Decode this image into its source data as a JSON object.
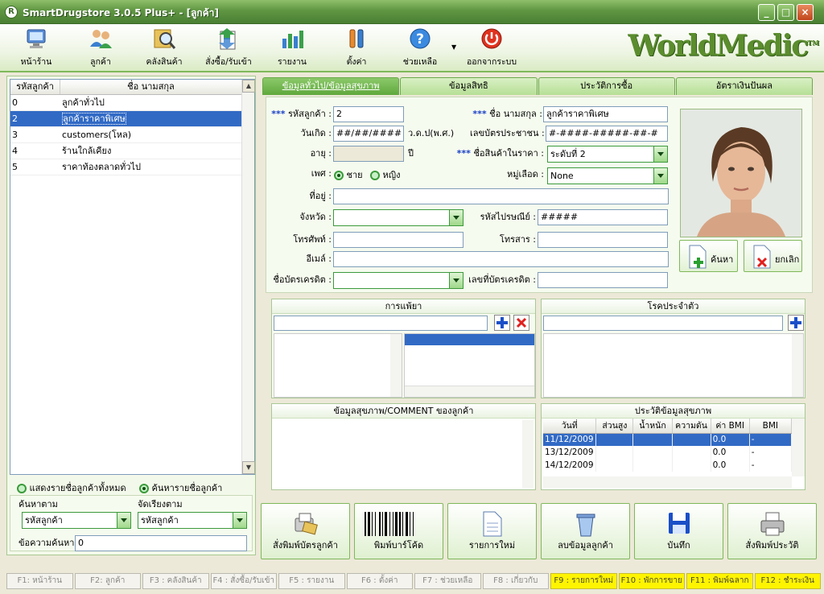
{
  "window": {
    "title": "SmartDrugstore 3.0.5 Plus+ - [ลูกค้า]",
    "brand": "WorldMedic",
    "brand_tm": "TM"
  },
  "toolbar": {
    "items": [
      {
        "label": "หน้าร้าน",
        "icon": "monitor-icon"
      },
      {
        "label": "ลูกค้า",
        "icon": "users-icon"
      },
      {
        "label": "คลังสินค้า",
        "icon": "box-search-icon"
      },
      {
        "label": "สั่งซื้อ/รับเข้า",
        "icon": "order-icon"
      },
      {
        "label": "รายงาน",
        "icon": "chart-icon"
      },
      {
        "label": "ตั้งค่า",
        "icon": "tools-icon"
      },
      {
        "label": "ช่วยเหลือ",
        "icon": "help-icon"
      },
      {
        "label": "ออกจากระบบ",
        "icon": "power-icon"
      }
    ]
  },
  "customer_list": {
    "columns": [
      "รหัสลูกค้า",
      "ชื่อ นามสกุล"
    ],
    "rows": [
      {
        "code": "0",
        "name": "ลูกค้าทั่วไป"
      },
      {
        "code": "2",
        "name": "ลูกค้าราคาพิเศษ"
      },
      {
        "code": "3",
        "name": "customers(โหล)"
      },
      {
        "code": "4",
        "name": "ร้านใกล้เคียง"
      },
      {
        "code": "5",
        "name": "ราคาท้องตลาดทั่วไป"
      }
    ],
    "selected": "2"
  },
  "search": {
    "show_all": "แสดงรายชื่อลูกค้าทั้งหมด",
    "search_names": "ค้นหารายชื่อลูกค้า",
    "search_by_label": "ค้นหาตาม",
    "search_by_value": "รหัสลูกค้า",
    "sort_by_label": "จัดเรียงตาม",
    "sort_by_value": "รหัสลูกค้า",
    "text_label": "ข้อความค้นหา",
    "text_value": "0"
  },
  "tabs": [
    "ข้อมูลทั่วไป/ข้อมูลสุขภาพ",
    "ข้อมูลสิทธิ",
    "ประวัติการซื้อ",
    "อัตราเงินปันผล"
  ],
  "form": {
    "req": "***",
    "code_label": "รหัสลูกค้า :",
    "code": "2",
    "name_label": "ชื่อ นามสกุล :",
    "name": "ลูกค้าราคาพิเศษ",
    "dob_label": "วันเกิด :",
    "dob": "##/##/####",
    "dob_suffix": "ว.ด.ป(พ.ศ.)",
    "id_label": "เลขบัตรประชาชน :",
    "id": "#-####-#####-##-#",
    "age_label": "อายุ :",
    "age": "",
    "age_suffix": "ปี",
    "price_label": "ชื่อสินค้าในราคา :",
    "price": "ระดับที่ 2",
    "sex_label": "เพศ :",
    "male": "ชาย",
    "female": "หญิง",
    "blood_label": "หมู่เลือด :",
    "blood": "None",
    "address_label": "ที่อยู่ :",
    "address": "",
    "province_label": "จังหวัด :",
    "province": "",
    "zip_label": "รหัสไปรษณีย์ :",
    "zip": "#####",
    "phone_label": "โทรศัพท์ :",
    "phone": "",
    "fax_label": "โทรสาร :",
    "fax": "",
    "email_label": "อีเมล์ :",
    "email": "",
    "card_label": "ชื่อบัตรเครดิต :",
    "card": "",
    "cardno_label": "เลขที่บัตรเครดิต :",
    "cardno": ""
  },
  "photo": {
    "search_btn": "ค้นหา",
    "cancel_btn": "ยกเลิก"
  },
  "allergy": {
    "title": "การแพ้ยา"
  },
  "disease": {
    "title": "โรคประจำตัว"
  },
  "comment": {
    "title": "ข้อมูลสุขภาพ/COMMENT ของลูกค้า"
  },
  "health": {
    "title": "ประวัติข้อมูลสุขภาพ",
    "columns": [
      "วันที่",
      "ส่วนสูง",
      "น้ำหนัก",
      "ความดัน",
      "ค่า BMI",
      "BMI"
    ],
    "rows": [
      {
        "date": "11/12/2009",
        "bmi_val": "0.0",
        "bmi": "-"
      },
      {
        "date": "13/12/2009",
        "bmi_val": "0.0",
        "bmi": "-"
      },
      {
        "date": "14/12/2009",
        "bmi_val": "0.0",
        "bmi": "-"
      }
    ]
  },
  "actions": [
    "สั่งพิมพ์บัตรลูกค้า",
    "พิมพ์บาร์โค้ด",
    "รายการใหม่",
    "ลบข้อมูลลูกค้า",
    "บันทึก",
    "สั่งพิมพ์ประวัติ"
  ],
  "status": [
    {
      "t": "F1: หน้าร้าน",
      "y": false
    },
    {
      "t": "F2: ลูกค้า",
      "y": false
    },
    {
      "t": "F3 : คลังสินค้า",
      "y": false
    },
    {
      "t": "F4 : สั่งซื้อ/รับเข้า",
      "y": false
    },
    {
      "t": "F5 : รายงาน",
      "y": false
    },
    {
      "t": "F6 : ตั้งค่า",
      "y": false
    },
    {
      "t": "F7 : ช่วยเหลือ",
      "y": false
    },
    {
      "t": "F8 : เกี่ยวกับ",
      "y": false
    },
    {
      "t": "F9 : รายการใหม่",
      "y": true
    },
    {
      "t": "F10 : พักการขาย",
      "y": true
    },
    {
      "t": "F11 : พิมพ์ฉลาก",
      "y": true
    },
    {
      "t": "F12 : ชำระเงิน",
      "y": true
    }
  ]
}
